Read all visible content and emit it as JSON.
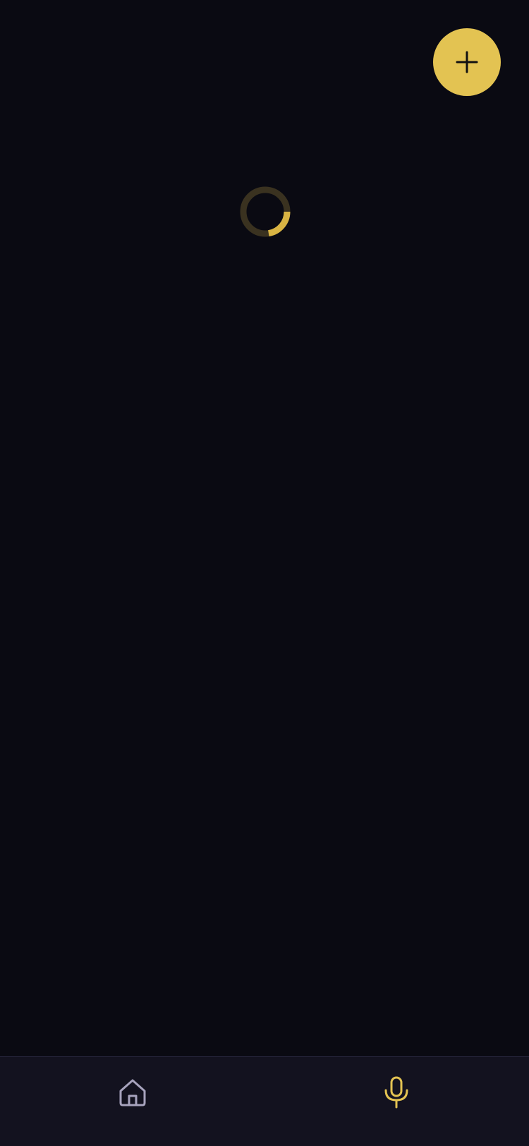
{
  "fab": {
    "icon": "plus-icon",
    "color": "#e3c352",
    "icon_color": "#111111"
  },
  "loading": {
    "icon": "loading-spinner",
    "track_color": "#3a3220",
    "arc_color": "#d9b443"
  },
  "bottom_nav": {
    "background": "#13121f",
    "items": [
      {
        "icon": "home-icon",
        "color": "#a7a3bd",
        "active": false
      },
      {
        "icon": "microphone-icon",
        "color": "#e3c352",
        "active": true
      }
    ]
  }
}
